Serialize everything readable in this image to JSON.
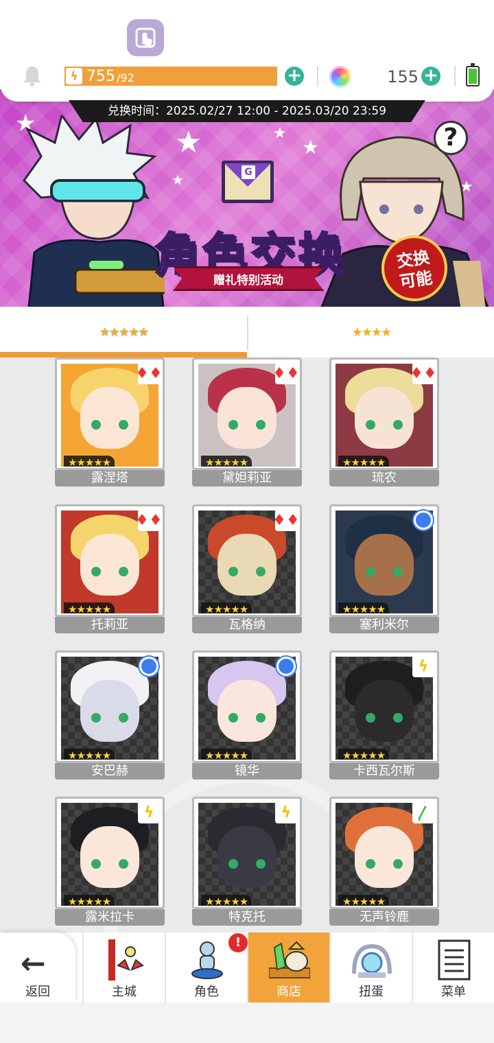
{
  "topbar": {
    "stamina_current": "755",
    "stamina_max": "/92",
    "gems": "155"
  },
  "banner": {
    "period": "兑换时间：2025.02/27 12:00 - 2025.03/20 23:59",
    "title": "角色交换",
    "subtitle": "赠礼特别活动",
    "badge_line1": "交换",
    "badge_line2": "可能",
    "help_label": "?"
  },
  "tabs": [
    {
      "label": "★★★★★"
    },
    {
      "label": "★★★★"
    }
  ],
  "characters": [
    {
      "name": "露涅塔",
      "stars": "★★★★★",
      "element": "fire"
    },
    {
      "name": "黛妲莉亚",
      "stars": "★★★★★",
      "element": "fire"
    },
    {
      "name": "琉农",
      "stars": "★★★★★",
      "element": "fire"
    },
    {
      "name": "托莉亚",
      "stars": "★★★★★",
      "element": "fire"
    },
    {
      "name": "瓦格纳",
      "stars": "★★★★★",
      "element": "fire"
    },
    {
      "name": "塞利米尔",
      "stars": "★★★★★",
      "element": "water"
    },
    {
      "name": "安巴赫",
      "stars": "★★★★★",
      "element": "water"
    },
    {
      "name": "镜华",
      "stars": "★★★★★",
      "element": "water"
    },
    {
      "name": "卡西瓦尔斯",
      "stars": "★★★★★",
      "element": "thunder"
    },
    {
      "name": "露米拉卡",
      "stars": "★★★★★",
      "element": "thunder"
    },
    {
      "name": "特克托",
      "stars": "★★★★★",
      "element": "thunder"
    },
    {
      "name": "无声铃鹿",
      "stars": "★★★★★",
      "element": "wind"
    }
  ],
  "nav": {
    "back": "返回",
    "items": [
      {
        "label": "主城"
      },
      {
        "label": "角色"
      },
      {
        "label": "商店"
      },
      {
        "label": "扭蛋"
      },
      {
        "label": "菜单"
      }
    ],
    "alert": "!"
  },
  "colors": {
    "accent": "#f2a33a",
    "teal": "#33b596"
  }
}
